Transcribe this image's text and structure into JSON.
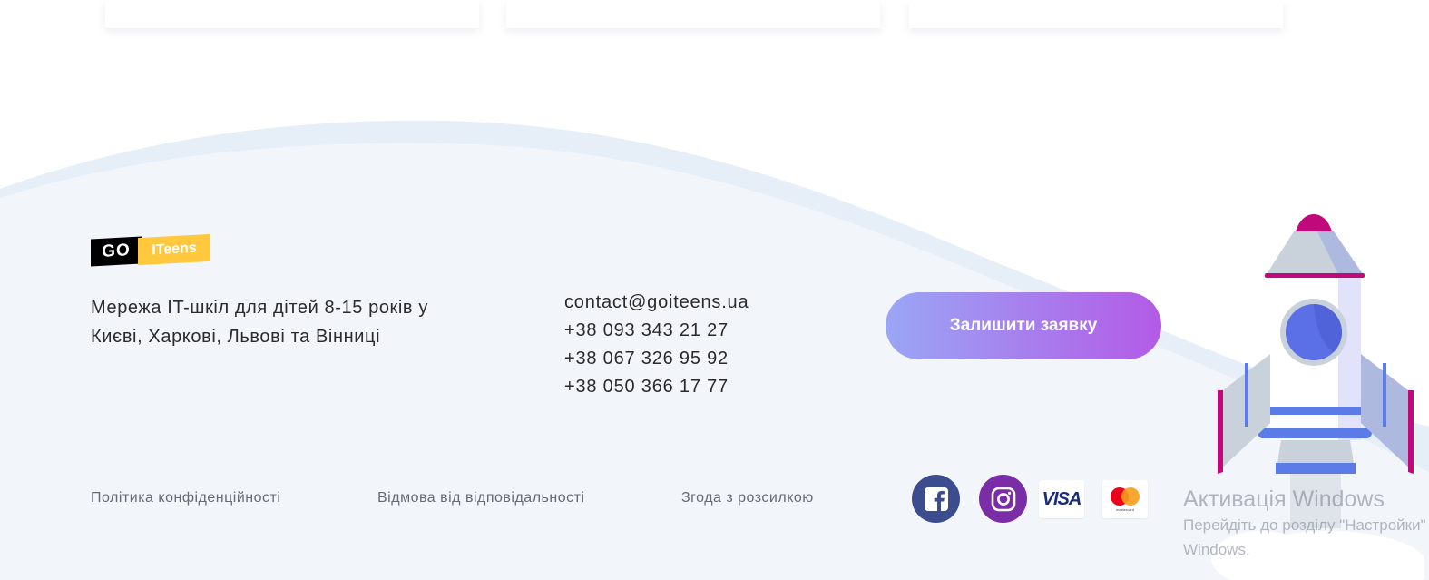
{
  "logo": {
    "go": "GO",
    "iteens": "ITeens"
  },
  "footer": {
    "description": "Мережа IT-шкіл для дітей 8-15 років у Києві, Харкові, Львові та Вінниці",
    "contacts": {
      "email": "contact@goiteens.ua",
      "phones": [
        "+38 093 343 21 27",
        "+38 067 326 95 92",
        "+38 050 366 17 77"
      ]
    },
    "cta_label": "Залишити заявку",
    "links": {
      "privacy": "Політика конфіденційності",
      "disclaimer": "Відмова від відповідальності",
      "newsletter": "Згода з розсилкою"
    },
    "payment": {
      "visa": "VISA",
      "mastercard": "mastercard"
    }
  },
  "icons": [
    "facebook-icon",
    "instagram-icon",
    "visa-icon",
    "mastercard-icon",
    "rocket-illustration"
  ],
  "colors": {
    "footer_bg": "#f2f6fb",
    "wave": "#e6eef8",
    "cta_start": "#9aa6f5",
    "cta_end": "#b35ae6",
    "logo_black": "#000000",
    "logo_yellow": "#ffc83d",
    "facebook": "#3b4d8c",
    "instagram": "#7a2da6"
  },
  "watermark": {
    "title": "Активація Windows",
    "line1": "Перейдіть до розділу \"Настройки\"",
    "line2": "Windows."
  }
}
